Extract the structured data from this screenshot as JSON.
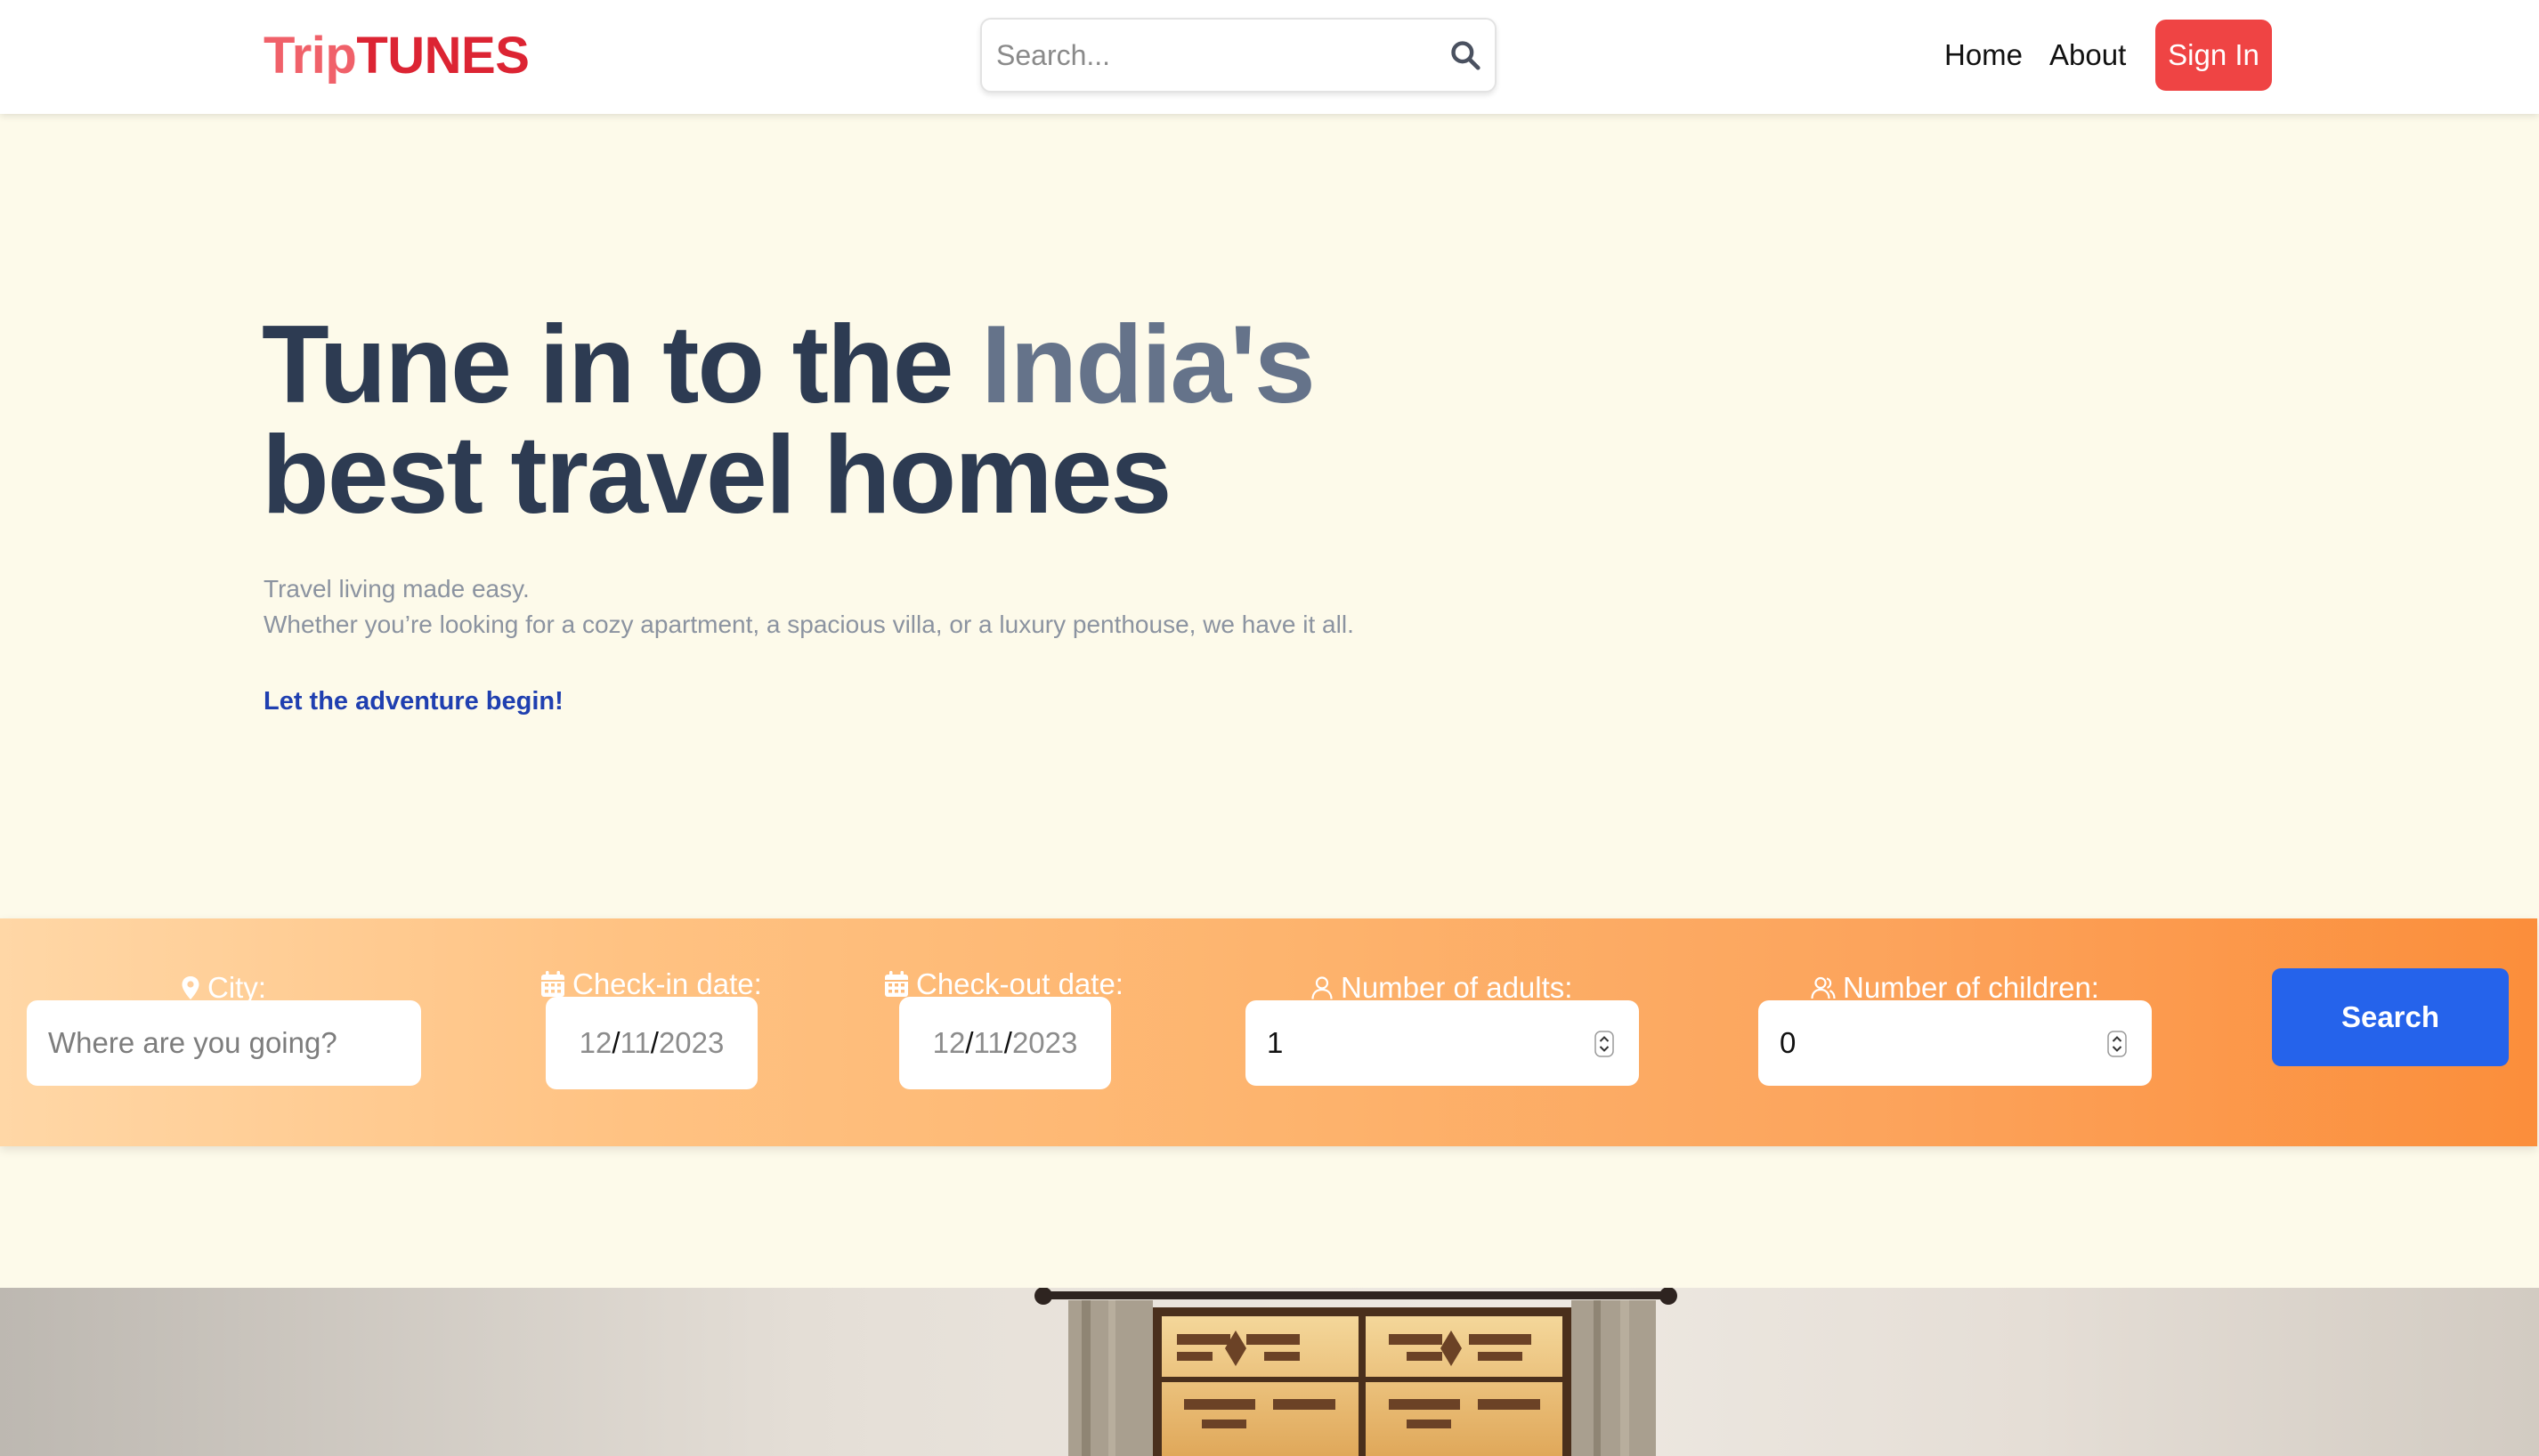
{
  "header": {
    "logo_part1": "Trip",
    "logo_part2": "TUNES",
    "search_placeholder": "Search...",
    "nav": {
      "home": "Home",
      "about": "About",
      "sign_in": "Sign In"
    }
  },
  "hero": {
    "title_part1": "Tune in to the ",
    "title_highlight": "India's",
    "title_part2": "best travel homes",
    "subtitle_line1": "Travel living made easy.",
    "subtitle_line2": "Whether you’re looking for a cozy apartment, a spacious villa, or a luxury penthouse, we have it all.",
    "cta": "Let the adventure begin!"
  },
  "booking": {
    "city_label": "City:",
    "city_placeholder": "Where are you going?",
    "checkin_label": "Check-in date:",
    "checkin": {
      "month": "12",
      "day": "11",
      "year": "2023"
    },
    "checkout_label": "Check-out date:",
    "checkout": {
      "month": "12",
      "day": "11",
      "year": "2023"
    },
    "adults_label": "Number of adults:",
    "adults_value": "1",
    "children_label": "Number of children:",
    "children_value": "0",
    "search_button": "Search"
  },
  "colors": {
    "brand_light": "#f0616a",
    "brand_dark": "#dc2433",
    "sign_in_bg": "#ef4444",
    "search_button_bg": "#2563eb",
    "hero_title": "#2d3b52",
    "hero_highlight": "#65738a",
    "cta": "#1f3fb0"
  },
  "icons": {
    "search": "search-icon",
    "city": "map-pin-icon",
    "dates": "calendar-icon",
    "adults": "user-icon",
    "children": "users-icon",
    "stepper": "stepper-icon"
  }
}
